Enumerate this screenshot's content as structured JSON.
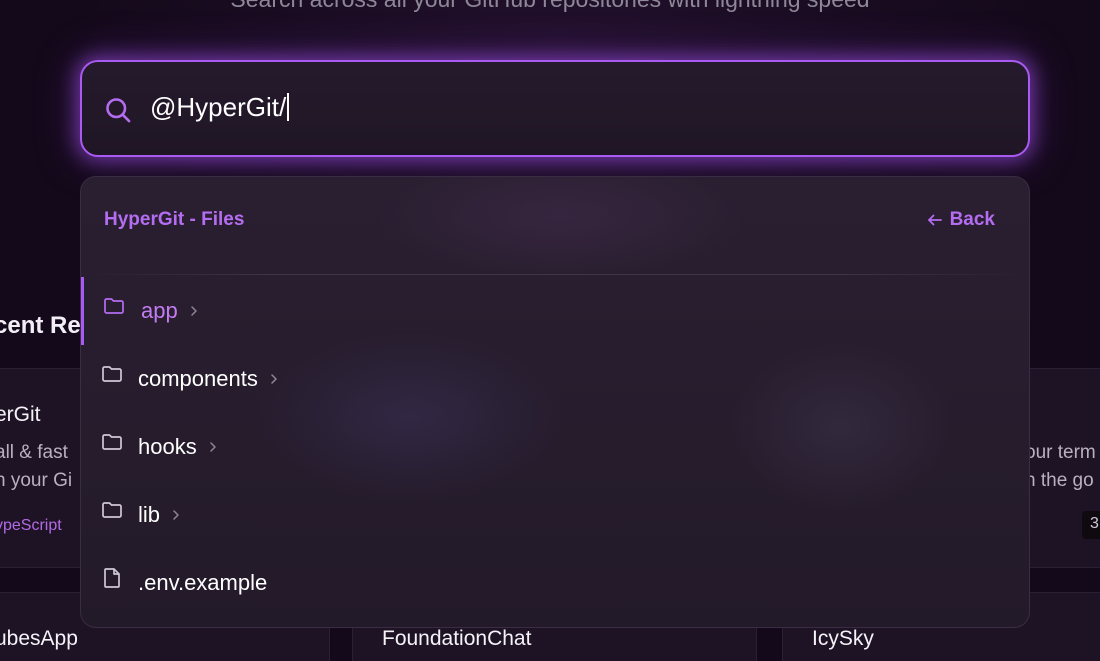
{
  "header": {
    "subtitle": "Search across all your GitHub repositories with lightning speed"
  },
  "search": {
    "value": "@HyperGit/",
    "icon": "search-icon"
  },
  "dropdown": {
    "title": "HyperGit - Files",
    "back_label": "Back",
    "items": [
      {
        "type": "folder",
        "label": "app",
        "active": true
      },
      {
        "type": "folder",
        "label": "components",
        "active": false
      },
      {
        "type": "folder",
        "label": "hooks",
        "active": false
      },
      {
        "type": "folder",
        "label": "lib",
        "active": false
      },
      {
        "type": "file",
        "label": ".env.example",
        "active": false
      }
    ]
  },
  "background": {
    "section_heading": "cent Re",
    "cards": [
      {
        "name": "erGit",
        "desc1": "all & fast",
        "desc2": "h your Gi",
        "lang": "ypeScript"
      },
      {
        "desc1": "our term",
        "desc2": "n the go",
        "badge": "3"
      },
      {
        "name": "ubesApp"
      },
      {
        "name": "FoundationChat"
      },
      {
        "name": "IcySky"
      }
    ]
  },
  "colors": {
    "accent": "#a95af0",
    "accent_text": "#b46df0",
    "background": "#14091a",
    "panel": "#261c2d"
  }
}
